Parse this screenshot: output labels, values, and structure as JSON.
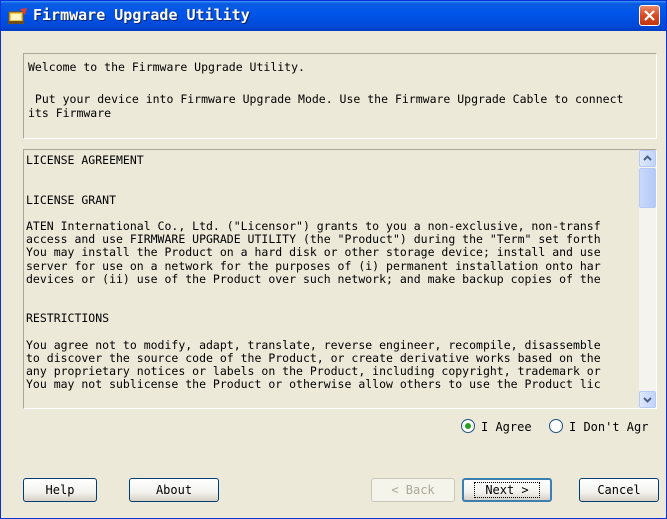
{
  "window": {
    "title": "Firmware Upgrade Utility"
  },
  "welcome": {
    "line1": "Welcome to the Firmware Upgrade Utility.",
    "line2": " Put your device into Firmware Upgrade Mode. Use the Firmware Upgrade Cable to connect",
    "line3": "its Firmware"
  },
  "license": {
    "lines": [
      "LICENSE AGREEMENT",
      "",
      "",
      "LICENSE GRANT",
      "",
      "ATEN International Co., Ltd. (\"Licensor\") grants to you a non-exclusive, non-transf",
      "access and use FIRMWARE UPGRADE UTILITY (the \"Product\") during the \"Term\" set forth",
      "You may install the Product on a hard disk or other storage device; install and use",
      "server for use on a network for the purposes of (i) permanent installation onto har",
      "devices or (ii) use of the Product over such network; and make backup copies of the",
      "",
      "",
      "RESTRICTIONS",
      "",
      "You agree not to modify, adapt, translate, reverse engineer, recompile, disassemble",
      "to discover the source code of the Product, or create derivative works based on the",
      "any proprietary notices or labels on the Product, including copyright, trademark or",
      "You may not sublicense the Product or otherwise allow others to use the Product lic"
    ]
  },
  "agreement": {
    "agree_label": "I Agree",
    "disagree_label": "I Don't Agr",
    "selected": "agree"
  },
  "buttons": {
    "help": "Help",
    "about": "About",
    "back": "< Back",
    "next": "Next >",
    "cancel": "Cancel"
  },
  "colors": {
    "titlebar": "#0055ea",
    "close": "#d94a25",
    "window_bg": "#ece9d8"
  }
}
